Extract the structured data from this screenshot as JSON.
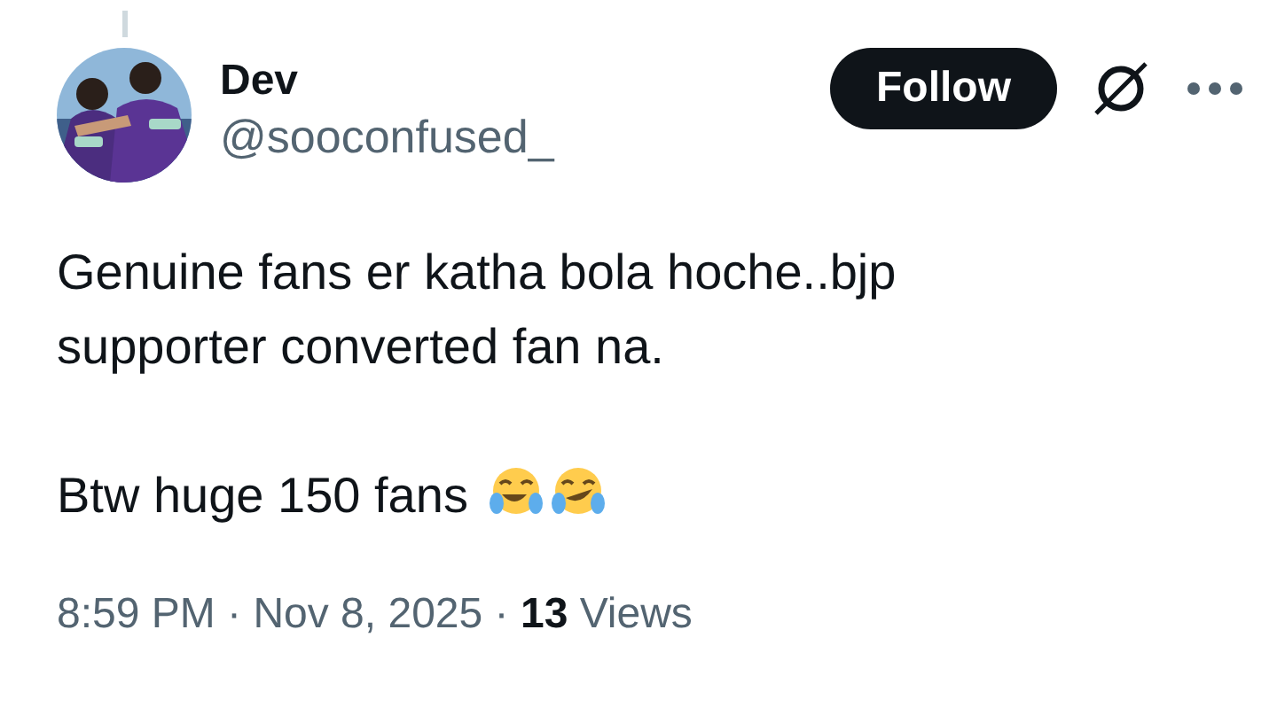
{
  "author": {
    "name": "Dev",
    "handle": "@sooconfused_"
  },
  "follow_button": {
    "label": "Follow"
  },
  "post": {
    "paragraphs": [
      {
        "text": "Genuine fans er katha bola hoche..bjp supporter converted fan na."
      },
      {
        "text": "Btw huge 150 fans",
        "emojis": [
          {
            "kind": "tears-of-joy"
          },
          {
            "kind": "rolling-laughing"
          }
        ]
      }
    ]
  },
  "meta": "8:59 PM · Nov 8, 2025 · **13** Views"
}
